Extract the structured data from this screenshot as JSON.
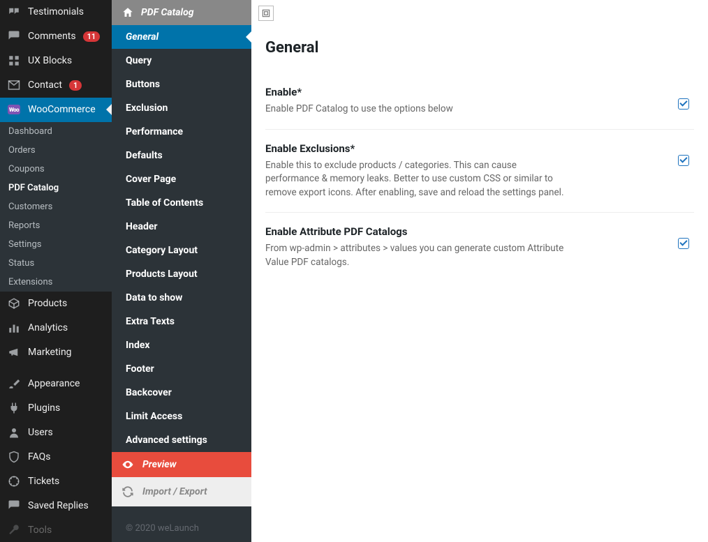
{
  "wp_sidebar": {
    "items": [
      {
        "name": "testimonials",
        "label": "Testimonials",
        "icon": "quote"
      },
      {
        "name": "comments",
        "label": "Comments",
        "icon": "comment",
        "badge": "11"
      },
      {
        "name": "uxblocks",
        "label": "UX Blocks",
        "icon": "grid"
      },
      {
        "name": "contact",
        "label": "Contact",
        "icon": "mail",
        "badge": "1"
      },
      {
        "name": "woocommerce",
        "label": "WooCommerce",
        "icon": "woo",
        "active": true
      }
    ],
    "submenu": [
      {
        "label": "Dashboard"
      },
      {
        "label": "Orders"
      },
      {
        "label": "Coupons"
      },
      {
        "label": "PDF Catalog",
        "current": true
      },
      {
        "label": "Customers"
      },
      {
        "label": "Reports"
      },
      {
        "label": "Settings"
      },
      {
        "label": "Status"
      },
      {
        "label": "Extensions"
      }
    ],
    "lower": [
      {
        "name": "products",
        "label": "Products",
        "icon": "box"
      },
      {
        "name": "analytics",
        "label": "Analytics",
        "icon": "bars"
      },
      {
        "name": "marketing",
        "label": "Marketing",
        "icon": "megaphone"
      }
    ],
    "bottom": [
      {
        "name": "appearance",
        "label": "Appearance",
        "icon": "brush"
      },
      {
        "name": "plugins",
        "label": "Plugins",
        "icon": "plug"
      },
      {
        "name": "users",
        "label": "Users",
        "icon": "user"
      },
      {
        "name": "faqs",
        "label": "FAQs",
        "icon": "help"
      },
      {
        "name": "tickets",
        "label": "Tickets",
        "icon": "ticket"
      },
      {
        "name": "savedreplies",
        "label": "Saved Replies",
        "icon": "reply"
      },
      {
        "name": "tools",
        "label": "Tools",
        "icon": "wrench"
      }
    ]
  },
  "mid_sidebar": {
    "title": "PDF Catalog",
    "items": [
      {
        "label": "General",
        "active": true
      },
      {
        "label": "Query"
      },
      {
        "label": "Buttons"
      },
      {
        "label": "Exclusion"
      },
      {
        "label": "Performance"
      },
      {
        "label": "Defaults"
      },
      {
        "label": "Cover Page"
      },
      {
        "label": "Table of Contents"
      },
      {
        "label": "Header"
      },
      {
        "label": "Category Layout"
      },
      {
        "label": "Products Layout"
      },
      {
        "label": "Data to show"
      },
      {
        "label": "Extra Texts"
      },
      {
        "label": "Index"
      },
      {
        "label": "Footer"
      },
      {
        "label": "Backcover"
      },
      {
        "label": "Limit Access"
      },
      {
        "label": "Advanced settings"
      }
    ],
    "preview_label": "Preview",
    "import_label": "Import / Export"
  },
  "main": {
    "section_title": "General",
    "fields": [
      {
        "label": "Enable*",
        "desc": "Enable PDF Catalog to use the options below",
        "checked": true
      },
      {
        "label": "Enable Exclusions*",
        "desc": "Enable this to exclude products / categories. This can cause performance & memory leaks. Better to use custom CSS or similar to remove export icons. After enabling, save and reload the settings panel.",
        "checked": true
      },
      {
        "label": "Enable Attribute PDF Catalogs",
        "desc": "From wp-admin > attributes > values you can generate custom Attribute Value PDF catalogs.",
        "checked": true
      }
    ]
  },
  "footer_credit": "© 2020 weLaunch"
}
